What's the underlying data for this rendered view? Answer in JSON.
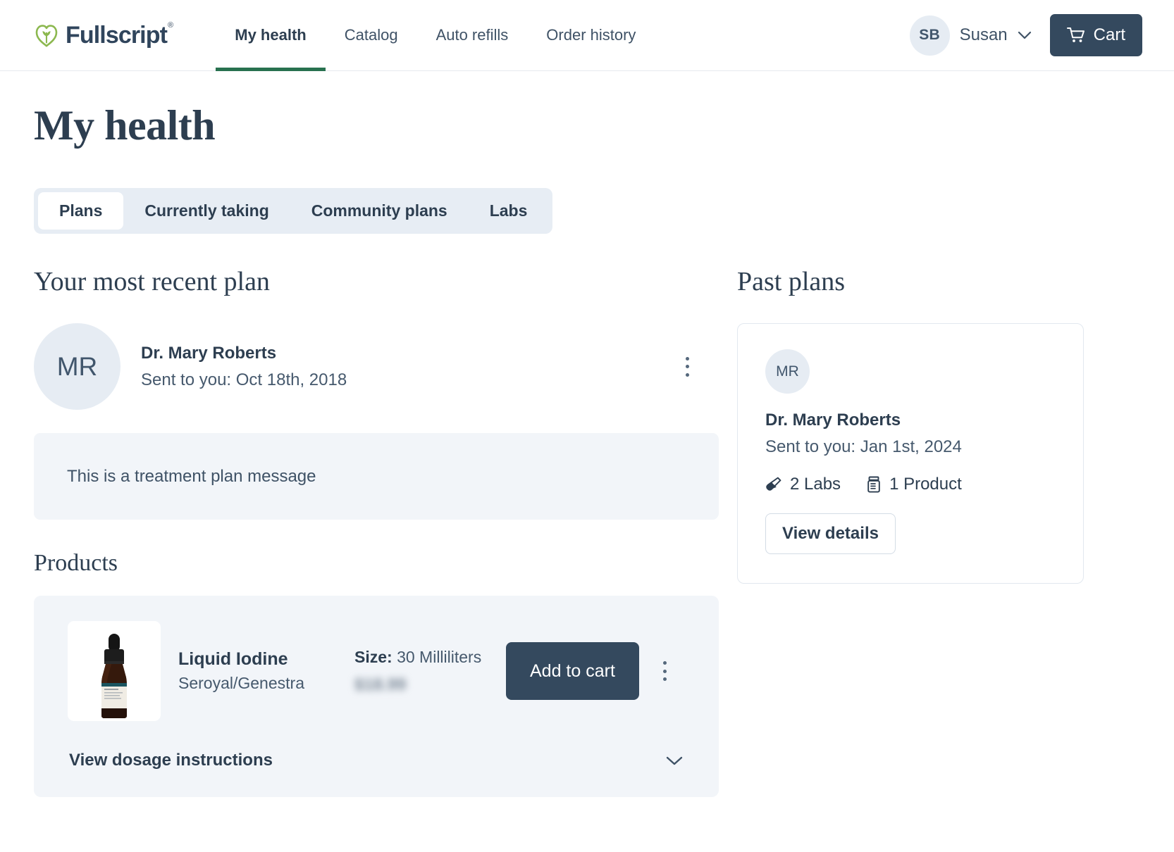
{
  "brand": {
    "name": "Fullscript",
    "trademark": "®",
    "logo_icon": "heart-leaf-icon",
    "green": "#8cb84f",
    "navy": "#30455c"
  },
  "nav": {
    "links": [
      {
        "label": "My health",
        "active": true
      },
      {
        "label": "Catalog",
        "active": false
      },
      {
        "label": "Auto refills",
        "active": false
      },
      {
        "label": "Order history",
        "active": false
      }
    ],
    "user": {
      "initials": "SB",
      "name": "Susan",
      "chevron_icon": "chevron-down-icon"
    },
    "cart": {
      "label": "Cart",
      "icon": "shopping-cart-icon"
    },
    "active_underline_color": "#28714f"
  },
  "header": {
    "title": "My health"
  },
  "tabs": [
    {
      "label": "Plans",
      "active": true
    },
    {
      "label": "Currently taking",
      "active": false
    },
    {
      "label": "Community plans",
      "active": false
    },
    {
      "label": "Labs",
      "active": false
    }
  ],
  "recent_plan": {
    "section_title": "Your most recent plan",
    "avatar_initials": "MR",
    "practitioner": "Dr. Mary Roberts",
    "sent": "Sent to you: Oct 18th, 2018",
    "menu_icon": "kebab-menu-icon",
    "message": "This is a treatment plan message",
    "products_title": "Products",
    "product": {
      "image_icon": "liquid-iodine-dropper-bottle",
      "name": "Liquid Iodine",
      "brand": "Seroyal/Genestra",
      "size_label": "Size:",
      "size_value": "30 Milliliters",
      "price": "$18.99",
      "add_to_cart_label": "Add to cart",
      "menu_icon": "kebab-menu-icon",
      "dosage_label": "View dosage instructions",
      "dosage_chevron_icon": "chevron-down-icon"
    }
  },
  "past_plans": {
    "section_title": "Past plans",
    "card": {
      "avatar_initials": "MR",
      "practitioner": "Dr. Mary Roberts",
      "sent": "Sent to you: Jan 1st, 2024",
      "labs_count": "2 Labs",
      "labs_icon": "test-tube-icon",
      "products_count": "1 Product",
      "products_icon": "pill-bottle-icon",
      "view_details_label": "View details"
    }
  },
  "colors": {
    "primary_navy": "#34495e",
    "text": "#2d3e50",
    "muted": "#46596d",
    "panel": "#f2f5f9",
    "tabbar": "#e7edf4",
    "avatar": "#e6ecf3"
  }
}
